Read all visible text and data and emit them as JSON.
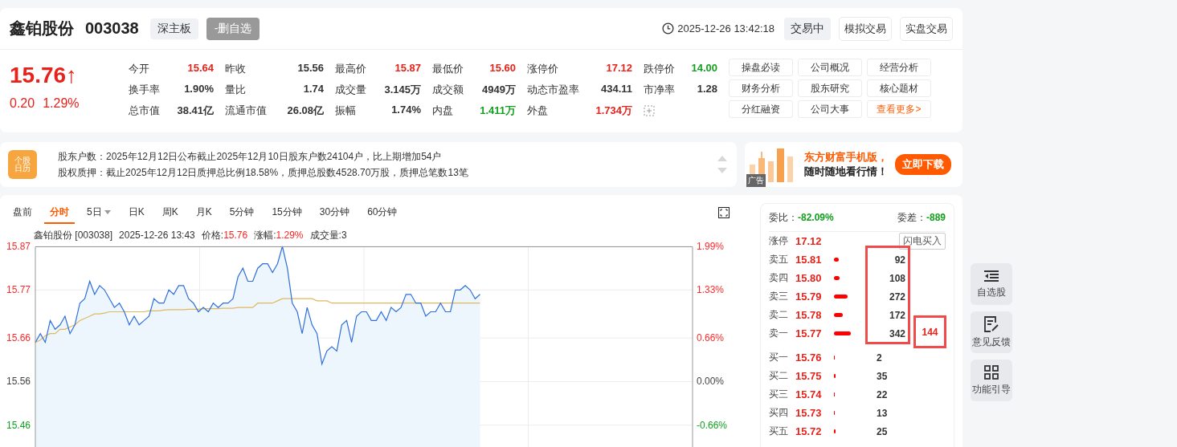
{
  "header": {
    "name": "鑫铂股份",
    "code": "003038",
    "board_tag": "深主板",
    "watch_button": "-删自选",
    "time": "2025-12-26 13:42:18",
    "status": "交易中",
    "buttons": [
      "模拟交易",
      "实盘交易"
    ]
  },
  "quote": {
    "price": "15.76",
    "arrow": "↑",
    "color": "#e6221b",
    "change": "0.20",
    "change_pct": "1.29%"
  },
  "stats": [
    [
      {
        "label": "今开",
        "value": "15.64",
        "color": "#e6221b"
      },
      {
        "label": "昨收",
        "value": "15.56",
        "color": "#333333"
      },
      {
        "label": "最高价",
        "value": "15.87",
        "color": "#e6221b"
      },
      {
        "label": "最低价",
        "value": "15.60",
        "color": "#e6221b"
      },
      {
        "label": "涨停价",
        "value": "17.12",
        "color": "#e6221b"
      },
      {
        "label": "跌停价",
        "value": "14.00",
        "color": "#13a01f"
      }
    ],
    [
      {
        "label": "换手率",
        "value": "1.90%",
        "color": "#333333"
      },
      {
        "label": "量比",
        "value": "1.74",
        "color": "#333333"
      },
      {
        "label": "成交量",
        "value": "3.145万",
        "color": "#333333"
      },
      {
        "label": "成交额",
        "value": "4949万",
        "color": "#333333"
      },
      {
        "label": "动态市盈率",
        "value": "434.11",
        "color": "#333333"
      },
      {
        "label": "市净率",
        "value": "1.28",
        "color": "#333333"
      }
    ],
    [
      {
        "label": "总市值",
        "value": "38.41亿",
        "color": "#333333"
      },
      {
        "label": "流通市值",
        "value": "26.08亿",
        "color": "#333333"
      },
      {
        "label": "振幅",
        "value": "1.74%",
        "color": "#333333"
      },
      {
        "label": "内盘",
        "value": "1.411万",
        "color": "#13a01f"
      },
      {
        "label": "外盘",
        "value": "1.734万",
        "color": "#e6221b"
      }
    ]
  ],
  "links": [
    {
      "label": "操盘必读",
      "kind": "normal"
    },
    {
      "label": "公司概况",
      "kind": "normal"
    },
    {
      "label": "经营分析",
      "kind": "normal"
    },
    {
      "label": "财务分析",
      "kind": "normal"
    },
    {
      "label": "股东研究",
      "kind": "normal"
    },
    {
      "label": "核心题材",
      "kind": "normal"
    },
    {
      "label": "分红融资",
      "kind": "normal"
    },
    {
      "label": "公司大事",
      "kind": "normal"
    },
    {
      "label": "查看更多>",
      "kind": "more"
    }
  ],
  "notice": {
    "icon_text": "个股日历",
    "lines": [
      "股东户数：2025年12月12日公布截止2025年12月10日股东户数24104户，比上期增加54户",
      "股权质押：截止2025年12月12日质押总比例18.58%，质押总股数4528.70万股，质押总笔数13笔"
    ]
  },
  "ad": {
    "tag": "广告",
    "headline": "东方财富手机版，",
    "subline": "随时随地看行情！",
    "button": "立即下载"
  },
  "chart_tabs": [
    {
      "label": "盘前",
      "selected": false,
      "dropdown": false
    },
    {
      "label": "分时",
      "selected": true,
      "dropdown": false
    },
    {
      "label": "5日",
      "selected": false,
      "dropdown": true
    },
    {
      "label": "日K",
      "selected": false,
      "dropdown": false
    },
    {
      "label": "周K",
      "selected": false,
      "dropdown": false
    },
    {
      "label": "月K",
      "selected": false,
      "dropdown": false
    },
    {
      "label": "5分钟",
      "selected": false,
      "dropdown": false
    },
    {
      "label": "15分钟",
      "selected": false,
      "dropdown": false
    },
    {
      "label": "30分钟",
      "selected": false,
      "dropdown": false
    },
    {
      "label": "60分钟",
      "selected": false,
      "dropdown": false
    }
  ],
  "chart_info": [
    {
      "text": "鑫铂股份 [003038]"
    },
    {
      "text": "2025-12-26 13:43"
    },
    {
      "text": "价格:",
      "value": "15.76"
    },
    {
      "text": "涨幅:",
      "value": "1.29%"
    },
    {
      "text": "成交量:3"
    }
  ],
  "chart_data": {
    "type": "area",
    "grid": true,
    "ylim": [
      15.41,
      15.87
    ],
    "yticks": [
      15.87,
      15.77,
      15.66,
      15.56,
      15.46
    ],
    "categories": [
      null,
      null,
      null,
      null,
      null,
      null,
      null,
      null,
      null,
      null,
      null,
      null,
      null,
      null,
      null,
      null,
      null,
      null,
      null,
      null,
      null,
      null,
      null,
      null,
      null,
      null,
      null,
      null,
      null,
      null,
      null,
      null,
      null,
      null,
      null,
      null,
      null,
      null,
      null,
      null,
      null,
      null,
      null,
      null,
      null,
      null,
      null,
      null,
      null,
      null,
      null,
      null,
      null,
      null,
      null,
      null,
      null,
      null,
      null,
      null,
      null,
      null,
      null,
      null,
      null,
      null,
      null,
      null,
      null,
      null,
      null,
      null,
      null,
      null,
      null,
      null,
      null,
      null,
      null,
      null,
      null,
      null,
      null,
      null,
      null,
      null,
      null,
      null,
      null,
      null,
      null,
      null,
      null,
      null,
      null,
      null,
      null,
      null,
      null,
      null,
      null,
      null,
      null,
      null,
      null,
      null,
      null,
      null,
      null,
      null,
      null,
      null,
      null,
      null,
      null,
      null,
      null,
      null,
      null,
      null,
      null,
      null,
      null,
      null,
      null,
      null,
      null,
      null,
      null,
      null,
      null,
      null,
      null,
      null
    ],
    "series": [
      {
        "color": "#2f6fdc",
        "type": "area",
        "values": [
          15.65,
          15.67,
          15.65,
          15.7,
          15.68,
          15.69,
          15.71,
          15.67,
          15.69,
          15.74,
          15.75,
          15.79,
          15.76,
          15.78,
          15.77,
          15.75,
          15.73,
          15.74,
          15.72,
          15.69,
          15.71,
          15.69,
          15.7,
          15.71,
          15.75,
          15.74,
          15.74,
          15.77,
          15.76,
          15.78,
          15.78,
          15.75,
          15.74,
          15.72,
          15.73,
          15.72,
          15.74,
          15.73,
          15.74,
          15.74,
          15.75,
          15.8,
          15.82,
          15.79,
          15.79,
          15.82,
          15.83,
          15.83,
          15.81,
          15.83,
          15.87,
          15.82,
          15.74,
          15.72,
          15.67,
          15.73,
          15.69,
          15.67,
          15.6,
          15.63,
          15.64,
          15.63,
          15.69,
          15.7,
          15.65,
          15.71,
          15.72,
          15.72,
          15.7,
          15.7,
          15.72,
          15.7,
          15.73,
          15.72,
          15.73,
          15.76,
          15.76,
          15.74,
          15.74,
          15.71,
          15.72,
          15.72,
          15.74,
          15.72,
          15.72,
          15.77,
          15.77,
          15.78,
          15.77,
          15.75,
          15.76,
          null,
          null,
          null,
          null,
          null,
          null,
          null,
          null,
          null,
          null,
          null,
          null,
          null,
          null,
          null,
          null,
          null,
          null,
          null,
          null,
          null,
          null,
          null,
          null,
          null,
          null,
          null,
          null,
          null,
          null,
          null,
          null,
          null,
          null,
          null,
          null,
          null,
          null,
          null,
          null,
          null,
          null,
          null
        ]
      },
      {
        "color": "#e0b860",
        "type": "line",
        "values": [
          15.65,
          15.655,
          15.665,
          15.67,
          15.67,
          15.68,
          15.68,
          15.685,
          15.69,
          15.7,
          15.705,
          15.71,
          15.715,
          15.715,
          15.717,
          15.72,
          15.72,
          15.72,
          15.72,
          15.72,
          15.72,
          15.72,
          15.72,
          15.722,
          15.722,
          15.722,
          15.724,
          15.725,
          15.725,
          15.725,
          15.725,
          15.726,
          15.726,
          15.726,
          15.727,
          15.727,
          15.727,
          15.727,
          15.728,
          15.728,
          15.728,
          15.73,
          15.73,
          15.73,
          15.73,
          15.74,
          15.74,
          15.74,
          15.74,
          15.745,
          15.75,
          15.75,
          15.75,
          15.75,
          15.75,
          15.75,
          15.75,
          15.745,
          15.745,
          15.745,
          15.74,
          15.74,
          15.74,
          15.74,
          15.74,
          15.74,
          15.74,
          15.74,
          15.74,
          15.74,
          15.74,
          15.74,
          15.74,
          15.74,
          15.74,
          15.74,
          15.74,
          15.74,
          15.74,
          15.74,
          15.74,
          15.74,
          15.74,
          15.74,
          15.74,
          15.74,
          15.74,
          15.74,
          15.74,
          15.74,
          15.74,
          null,
          null,
          null,
          null,
          null,
          null,
          null,
          null,
          null,
          null,
          null,
          null,
          null,
          null,
          null,
          null,
          null,
          null,
          null,
          null,
          null,
          null,
          null,
          null,
          null,
          null,
          null,
          null,
          null,
          null,
          null,
          null,
          null,
          null,
          null,
          null,
          null,
          null,
          null,
          null,
          null,
          null,
          null
        ]
      }
    ]
  },
  "pct_axis": [
    {
      "text": "1.99%",
      "color": "#ff2a2a"
    },
    {
      "text": "1.33%",
      "color": "#ff2a2a"
    },
    {
      "text": "0.66%",
      "color": "#ff2a2a"
    },
    {
      "text": "0.00%",
      "color": "#444444"
    },
    {
      "text": "-0.66%",
      "color": "#13a01f"
    }
  ],
  "order_book": {
    "ratio_label": "委比：",
    "ratio": "-82.09%",
    "diff_label": "委差：",
    "diff": "-889",
    "color": "#13a01f",
    "limit_label": "涨停",
    "limit_price": "17.12",
    "flash_button": "闪电买入",
    "asks": [
      {
        "label": "卖五",
        "price": "15.81",
        "volume": "92"
      },
      {
        "label": "卖四",
        "price": "15.80",
        "volume": "108"
      },
      {
        "label": "卖三",
        "price": "15.79",
        "volume": "272"
      },
      {
        "label": "卖二",
        "price": "15.78",
        "volume": "172"
      },
      {
        "label": "卖一",
        "price": "15.77",
        "volume": "342"
      }
    ],
    "bids": [
      {
        "label": "买一",
        "price": "15.76",
        "volume": "2"
      },
      {
        "label": "买二",
        "price": "15.75",
        "volume": "35"
      },
      {
        "label": "买三",
        "price": "15.74",
        "volume": "22"
      },
      {
        "label": "买四",
        "price": "15.73",
        "volume": "13"
      },
      {
        "label": "买五",
        "price": "15.72",
        "volume": "25"
      }
    ],
    "asks_highlighted": true,
    "highlight_note": "144"
  },
  "side_tools": [
    {
      "label": "自选股",
      "kind": "list"
    },
    {
      "label": "意见反馈",
      "kind": "feedback"
    },
    {
      "label": "功能引导",
      "kind": "grid"
    }
  ]
}
